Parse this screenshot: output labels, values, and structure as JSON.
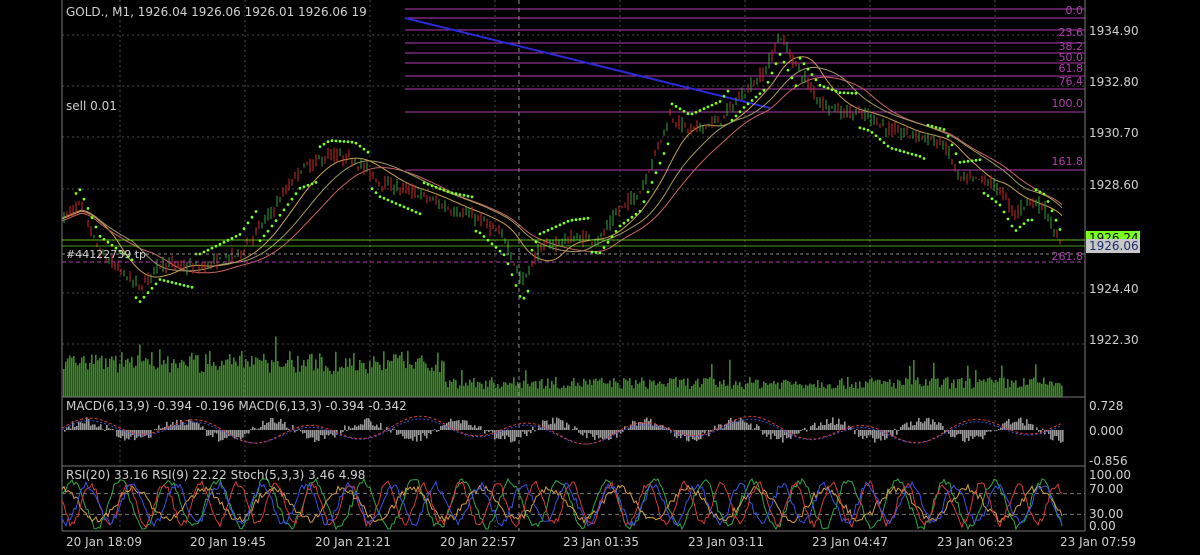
{
  "header": {
    "symbol_line": "GOLD., M1, 1926.04 1926.06 1926.01 1926.06 19",
    "sell_label": "sell 0.01",
    "order_label": "#44122739 tp"
  },
  "price_axis": {
    "ticks": [
      "1934.90",
      "1932.80",
      "1930.70",
      "1928.60",
      "1924.40",
      "1922.30"
    ],
    "bid_tag": "1926.24",
    "current_price_tag": "1926.06"
  },
  "fibonacci": {
    "levels": [
      "0.0",
      "23.6",
      "38.2",
      "50.0",
      "61.8",
      "76.4",
      "100.0",
      "161.8",
      "261.8"
    ]
  },
  "macd_panel": {
    "label": "MACD(6,13,9) -0.394 -0.196 MACD(6,13,3) -0.394 -0.342",
    "ticks": [
      "0.728",
      "0.000",
      "-0.856"
    ]
  },
  "rsi_panel": {
    "label": "RSI(20) 33.16 RSI(9) 22.22 Stoch(5,3,3) 3.46 4.98",
    "ticks": [
      "100.00",
      "70.00",
      "30.00",
      "0.00"
    ]
  },
  "time_axis": {
    "labels": [
      "20 Jan 18:09",
      "20 Jan 19:45",
      "20 Jan 21:21",
      "20 Jan 22:57",
      "23 Jan 01:35",
      "23 Jan 03:11",
      "23 Jan 04:47",
      "23 Jan 06:23",
      "23 Jan 07:59"
    ]
  },
  "colors": {
    "background": "#000000",
    "grid": "#4a4a4a",
    "text": "#cccccc",
    "fib": "#b03cb0",
    "trendline": "#2a2ad8",
    "sar": "#7dff1e",
    "volume": "#3c8c28",
    "current_price": "#1c2e6e"
  },
  "chart_data": [
    {
      "type": "line",
      "title": "GOLD., M1",
      "x": [
        "20 Jan 18:09",
        "20 Jan 19:45",
        "20 Jan 21:21",
        "20 Jan 22:57",
        "23 Jan 01:35",
        "23 Jan 03:11",
        "23 Jan 04:47",
        "23 Jan 06:23",
        "23 Jan 07:59"
      ],
      "series": [
        {
          "values": [
            1926.0,
            1926.7,
            1930.3,
            1928.5,
            1926.2,
            1932.0,
            1932.3,
            1929.1,
            1926.1
          ]
        }
      ],
      "ylim": [
        1921.5,
        1935.6
      ]
    },
    {
      "type": "line",
      "title": "MACD(6,13,9)",
      "ylim": [
        -0.856,
        0.728
      ]
    },
    {
      "type": "line",
      "title": "RSI(20) / RSI(9) / Stoch(5,3,3)",
      "ylim": [
        0,
        100
      ]
    }
  ]
}
